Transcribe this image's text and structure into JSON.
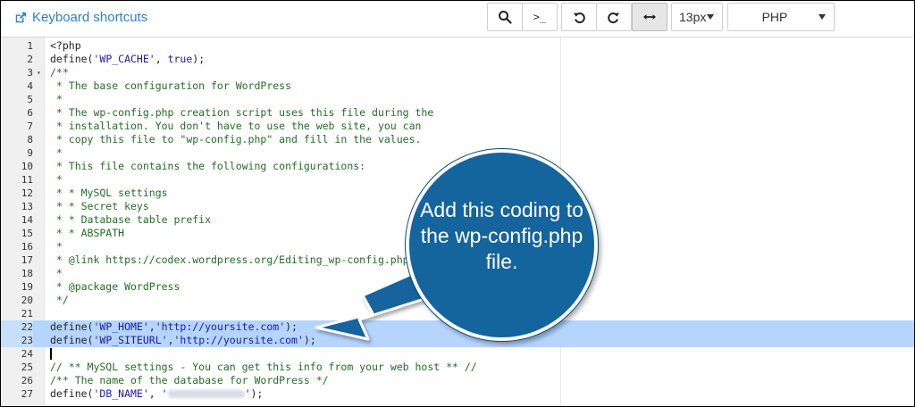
{
  "toolbar": {
    "keyboard_shortcuts": "Keyboard shortcuts",
    "search_icon": "search-icon",
    "terminal_label": ">_",
    "undo_icon": "undo-icon",
    "redo_icon": "redo-icon",
    "wrap_icon": "horizontal-arrows-icon",
    "font_size": "13px",
    "language": "PHP"
  },
  "editor": {
    "lines": [
      {
        "n": "1",
        "segs": [
          {
            "t": "<?php"
          }
        ]
      },
      {
        "n": "2",
        "segs": [
          {
            "t": "define("
          },
          {
            "t": "'WP_CACHE'",
            "c": "str"
          },
          {
            "t": ", "
          },
          {
            "t": "true",
            "c": "kw"
          },
          {
            "t": ");"
          }
        ]
      },
      {
        "n": "3",
        "fold": true,
        "segs": [
          {
            "t": "/**",
            "c": "cmt"
          }
        ]
      },
      {
        "n": "4",
        "segs": [
          {
            "t": " * The base configuration for WordPress",
            "c": "cmt"
          }
        ]
      },
      {
        "n": "5",
        "segs": [
          {
            "t": " *",
            "c": "cmt"
          }
        ]
      },
      {
        "n": "6",
        "segs": [
          {
            "t": " * The wp-config.php creation script uses this file during the",
            "c": "cmt"
          }
        ]
      },
      {
        "n": "7",
        "segs": [
          {
            "t": " * installation. You don't have to use the web site, you can",
            "c": "cmt"
          }
        ]
      },
      {
        "n": "8",
        "segs": [
          {
            "t": " * copy this file to \"wp-config.php\" and fill in the values.",
            "c": "cmt"
          }
        ]
      },
      {
        "n": "9",
        "segs": [
          {
            "t": " *",
            "c": "cmt"
          }
        ]
      },
      {
        "n": "10",
        "segs": [
          {
            "t": " * This file contains the following configurations:",
            "c": "cmt"
          }
        ]
      },
      {
        "n": "11",
        "segs": [
          {
            "t": " *",
            "c": "cmt"
          }
        ]
      },
      {
        "n": "12",
        "segs": [
          {
            "t": " * * MySQL settings",
            "c": "cmt"
          }
        ]
      },
      {
        "n": "13",
        "segs": [
          {
            "t": " * * Secret keys",
            "c": "cmt"
          }
        ]
      },
      {
        "n": "14",
        "segs": [
          {
            "t": " * * Database table prefix",
            "c": "cmt"
          }
        ]
      },
      {
        "n": "15",
        "segs": [
          {
            "t": " * * ABSPATH",
            "c": "cmt"
          }
        ]
      },
      {
        "n": "16",
        "segs": [
          {
            "t": " *",
            "c": "cmt"
          }
        ]
      },
      {
        "n": "17",
        "segs": [
          {
            "t": " * @link https://codex.wordpress.org/Editing_wp-config.php",
            "c": "cmt"
          }
        ]
      },
      {
        "n": "18",
        "segs": [
          {
            "t": " *",
            "c": "cmt"
          }
        ]
      },
      {
        "n": "19",
        "segs": [
          {
            "t": " * @package WordPress",
            "c": "cmt"
          }
        ]
      },
      {
        "n": "20",
        "segs": [
          {
            "t": " */",
            "c": "cmt"
          }
        ]
      },
      {
        "n": "21",
        "segs": []
      },
      {
        "n": "22",
        "hl": true,
        "segs": [
          {
            "t": "define("
          },
          {
            "t": "'WP_HOME'",
            "c": "str"
          },
          {
            "t": ","
          },
          {
            "t": "'http://yoursite.com'",
            "c": "str"
          },
          {
            "t": ");"
          }
        ]
      },
      {
        "n": "23",
        "hl": true,
        "segs": [
          {
            "t": "define("
          },
          {
            "t": "'WP_SITEURL'",
            "c": "str"
          },
          {
            "t": ","
          },
          {
            "t": "'http://yoursite.com'",
            "c": "str"
          },
          {
            "t": ");"
          }
        ]
      },
      {
        "n": "24",
        "cursor": true,
        "segs": []
      },
      {
        "n": "25",
        "segs": [
          {
            "t": "// ** MySQL settings - You can get this info from your web host ** //",
            "c": "cmt"
          }
        ]
      },
      {
        "n": "26",
        "segs": [
          {
            "t": "/** The name of the database for WordPress */",
            "c": "cmt"
          }
        ]
      },
      {
        "n": "27",
        "blur": true,
        "segs": [
          {
            "t": "define("
          },
          {
            "t": "'DB_NAME'",
            "c": "str"
          },
          {
            "t": ", '",
            "c": "str"
          }
        ],
        "tail": "');"
      }
    ]
  },
  "callout": {
    "text": "Add this coding to the wp-config.php file.",
    "color": "#14649e"
  },
  "colors": {
    "accent": "#2b83c6",
    "highlight": "#b5d5ff",
    "comment": "#236e24",
    "string": "#1a1aa6"
  }
}
